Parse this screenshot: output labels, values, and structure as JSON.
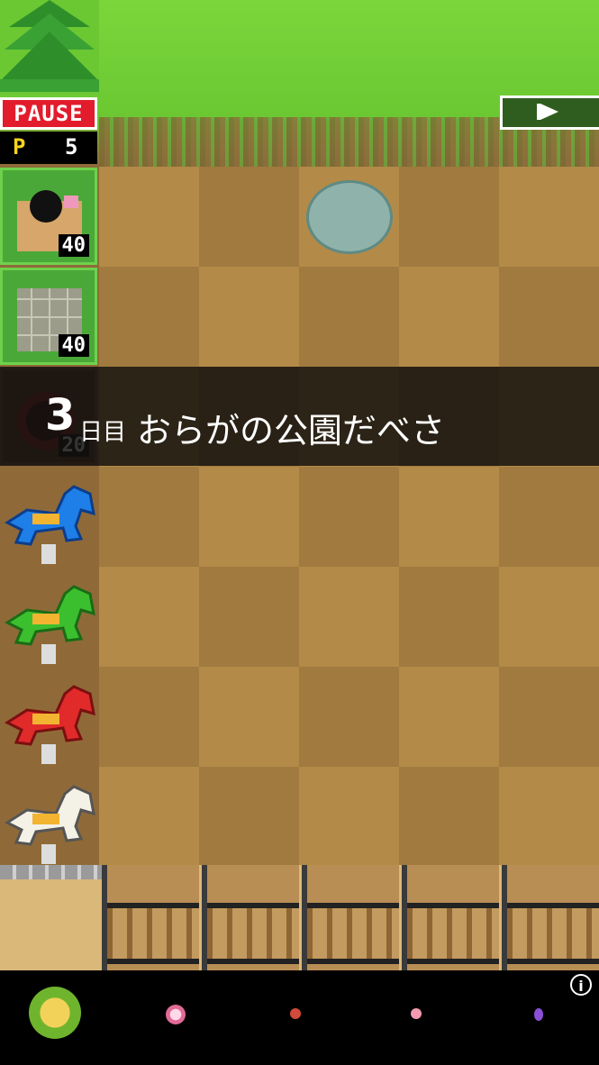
{
  "hud": {
    "pause_label": "PAUSE",
    "p_label": "P",
    "p_value": "5",
    "fast_forward_icon": "play-flag-icon"
  },
  "cards": [
    {
      "name": "cannon-card",
      "cost": "40"
    },
    {
      "name": "net-card",
      "cost": "40"
    },
    {
      "name": "bomb-card",
      "cost": "20"
    }
  ],
  "banner": {
    "day_number": "3",
    "day_unit": "日目",
    "message": "おらがの公園だべさ"
  },
  "lanes": [
    {
      "horse_color": "#1e7fe8"
    },
    {
      "horse_color": "#3cbf2e"
    },
    {
      "horse_color": "#e12a2a"
    },
    {
      "horse_color": "#f4f1e6"
    }
  ],
  "bottombar": {
    "info_label": "i",
    "items": [
      "cabbage-icon",
      "pink-flower-icon",
      "small-flower-icon",
      "bud-icon",
      "purple-bud-icon"
    ]
  }
}
